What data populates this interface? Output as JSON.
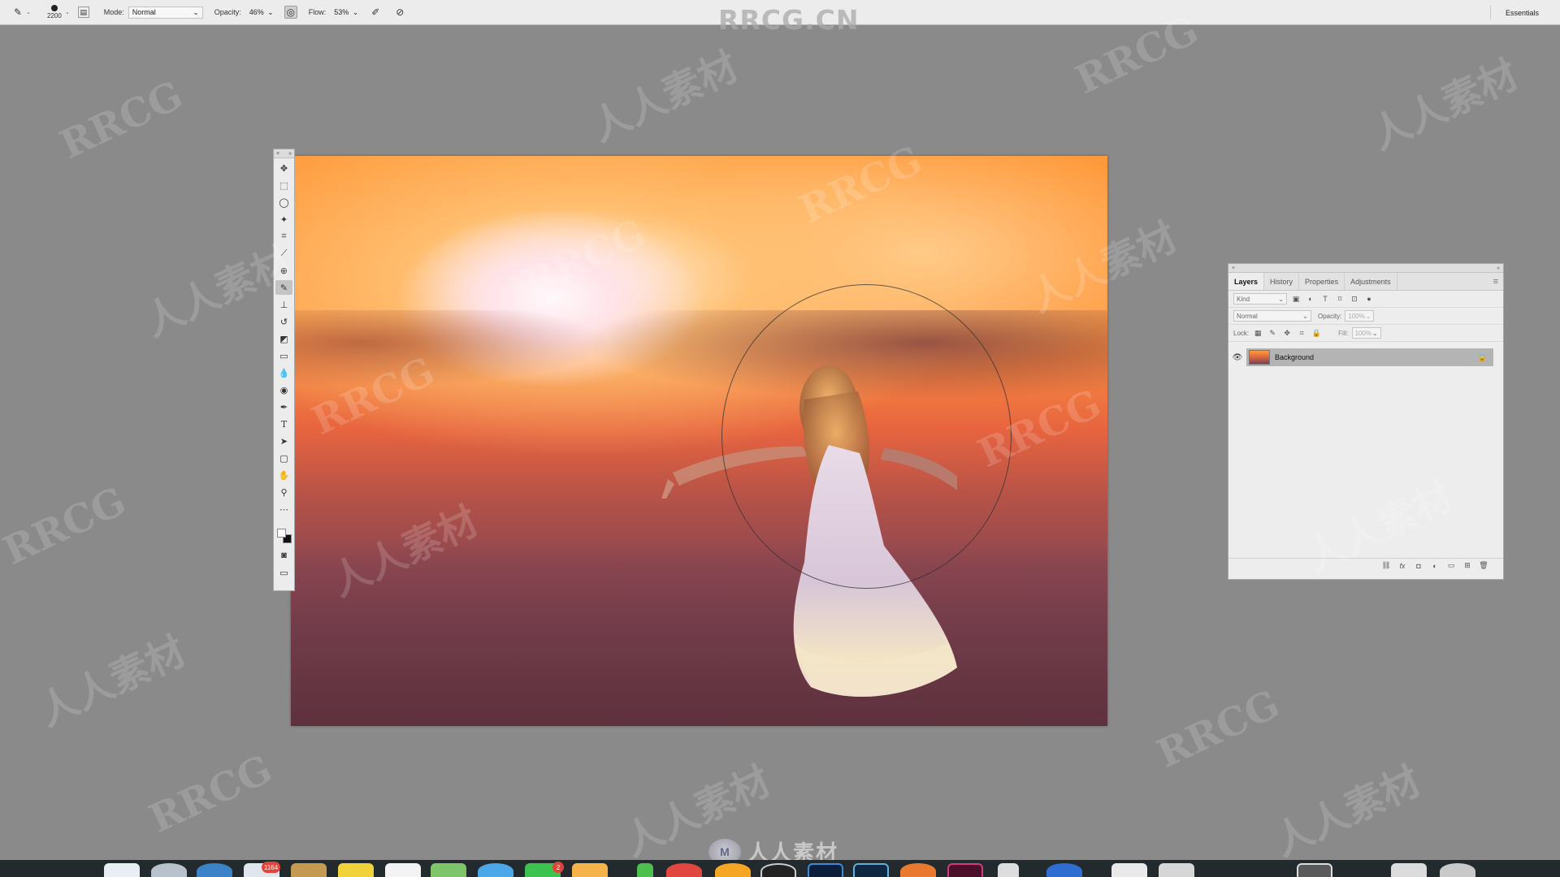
{
  "options_bar": {
    "brush_size": "2200",
    "mode_label": "Mode:",
    "mode_value": "Normal",
    "opacity_label": "Opacity:",
    "opacity_value": "46%",
    "flow_label": "Flow:",
    "flow_value": "53%",
    "workspace": "Essentials"
  },
  "watermark_top": "RRCG.CN",
  "watermark_tiles": [
    "RRCG",
    "人人素材"
  ],
  "watermark_bottom": "人人素材",
  "tools_panel": {
    "tools": [
      "move-tool",
      "marquee-tool",
      "lasso-tool",
      "quick-selection-tool",
      "crop-tool",
      "eyedropper-tool",
      "spot-healing-tool",
      "brush-tool",
      "clone-stamp-tool",
      "history-brush-tool",
      "eraser-tool",
      "gradient-tool",
      "blur-tool",
      "dodge-tool",
      "pen-tool",
      "type-tool",
      "path-selection-tool",
      "rectangle-tool",
      "hand-tool",
      "zoom-tool",
      "edit-toolbar"
    ],
    "active_tool": "brush-tool",
    "foreground_color": "#ffffff",
    "background_color": "#111111"
  },
  "layers_panel": {
    "tabs": [
      "Layers",
      "History",
      "Properties",
      "Adjustments"
    ],
    "active_tab": "Layers",
    "filter_label": "Kind",
    "blend_mode": "Normal",
    "opacity_label": "Opacity:",
    "opacity_value": "100%",
    "lock_label": "Lock:",
    "fill_label": "Fill:",
    "fill_value": "100%",
    "layers": [
      {
        "name": "Background",
        "visible": true,
        "locked": true,
        "selected": true
      }
    ]
  },
  "dock": {
    "mail_badge": "1164",
    "messages_badge": "2"
  },
  "colors": {
    "workspace_bg": "#8a8a8a",
    "panel_bg": "#ededed",
    "selected_layer": "#b4b4b4",
    "dock_bg": "#222a2d"
  }
}
